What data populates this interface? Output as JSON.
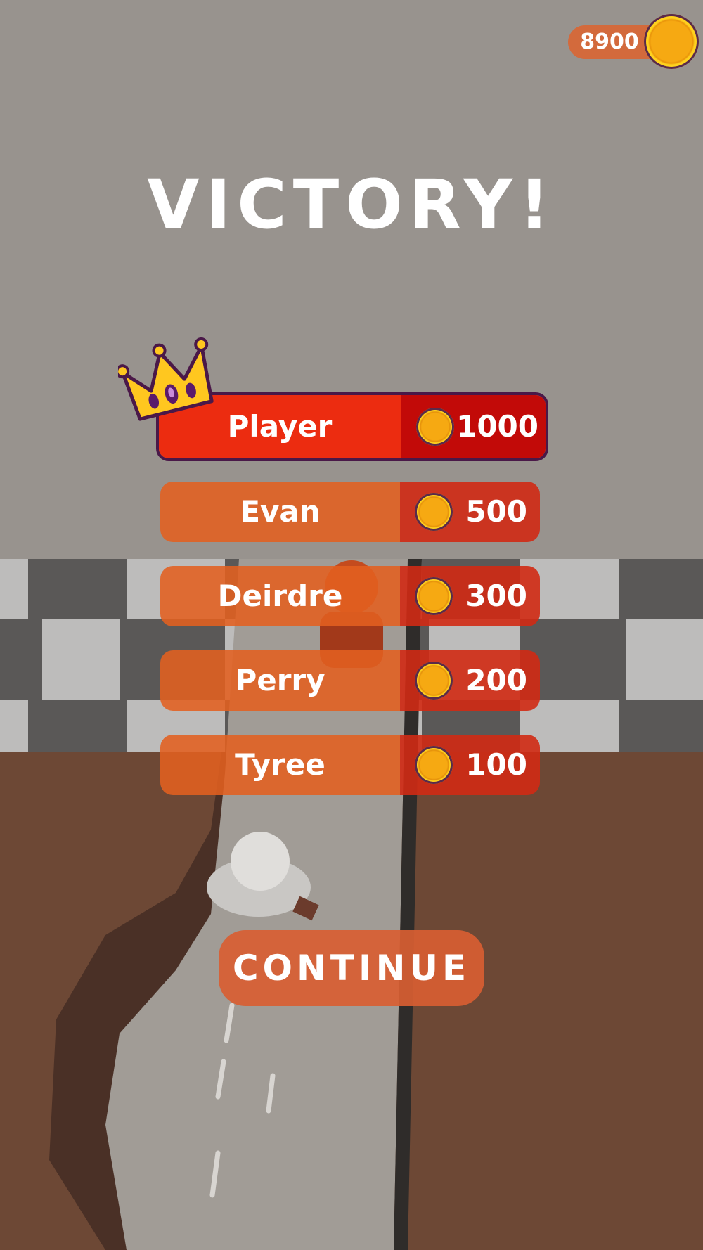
{
  "hud": {
    "coin_total": "8900"
  },
  "title": "VICTORY!",
  "leaderboard": [
    {
      "name": "Player",
      "score": "1000"
    },
    {
      "name": "Evan",
      "score": "500"
    },
    {
      "name": "Deirdre",
      "score": "300"
    },
    {
      "name": "Perry",
      "score": "200"
    },
    {
      "name": "Tyree",
      "score": "100"
    }
  ],
  "continue_label": "CONTINUE",
  "icons": {
    "coin": "coin-icon",
    "crown": "crown-icon"
  },
  "colors": {
    "accent_orange": "#e26020",
    "accent_red": "#d02a14",
    "top_row_red": "#ec2c10",
    "coin_gold": "#f6a912"
  }
}
